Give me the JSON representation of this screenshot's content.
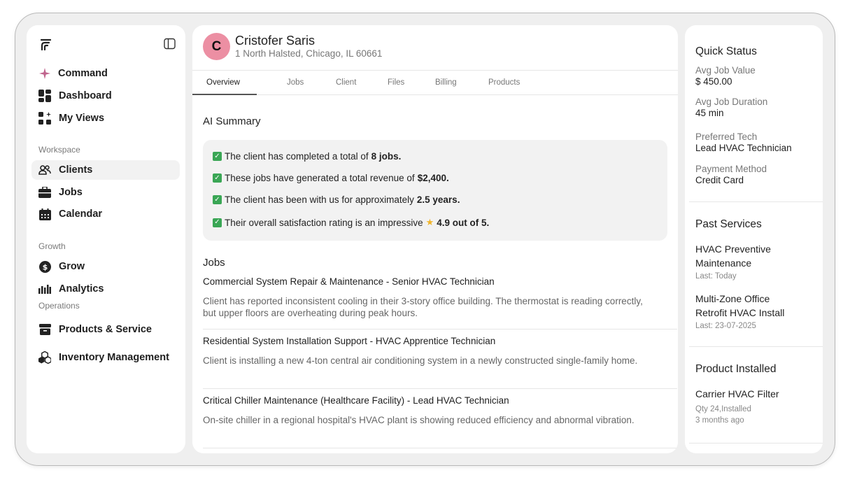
{
  "sidebar": {
    "primary": [
      {
        "label": "Command",
        "icon": "sparkle-icon"
      },
      {
        "label": "Dashboard",
        "icon": "dashboard-grid-icon"
      },
      {
        "label": "My Views",
        "icon": "my-views-icon"
      }
    ],
    "workspace_label": "Workspace",
    "workspace": [
      {
        "label": "Clients",
        "icon": "users-icon"
      },
      {
        "label": "Jobs",
        "icon": "briefcase-icon"
      },
      {
        "label": "Calendar",
        "icon": "calendar-icon"
      }
    ],
    "growth_label": "Growth",
    "growth": [
      {
        "label": "Grow",
        "icon": "dollar-coin-icon"
      },
      {
        "label": "Analytics",
        "icon": "bar-chart-icon"
      }
    ],
    "operations_label": "Operations",
    "operations": [
      {
        "label": "Products & Service",
        "icon": "box-icon"
      },
      {
        "label": "Inventory Management",
        "icon": "boxes-icon"
      }
    ]
  },
  "client": {
    "initial": "C",
    "name": "Cristofer Saris",
    "address": "1 North Halsted, Chicago, IL 60661",
    "avatar_color": "#ec8fa3"
  },
  "tabs": [
    "Overview",
    "Jobs",
    "Client",
    "Files",
    "Billing",
    "Products"
  ],
  "ai_summary": {
    "title": "AI Summary",
    "lines": [
      {
        "text": "The client has completed a total of",
        "bold": "8 jobs."
      },
      {
        "text": "These jobs have generated a total revenue of",
        "bold": "$2,400."
      },
      {
        "text": "The client has been with us for approximately",
        "bold": "2.5 years."
      },
      {
        "text": "Their overall satisfaction rating is an impressive",
        "bold": "4.9 out of 5."
      }
    ]
  },
  "jobs": {
    "title": "Jobs",
    "items": [
      {
        "title": "Commercial System Repair & Maintenance - Senior HVAC Technician",
        "desc": "Client has reported inconsistent cooling in their 3-story office building. The thermostat is reading correctly, but upper floors are overheating during peak hours."
      },
      {
        "title": "Residential System Installation Support - HVAC Apprentice Technician",
        "desc": "Client is installing a new 4-ton central air conditioning system in a newly constructed single-family home."
      },
      {
        "title": "Critical Chiller Maintenance (Healthcare Facility) - Lead HVAC Technician",
        "desc": "On-site chiller in a regional hospital's HVAC plant is showing reduced efficiency and abnormal vibration."
      }
    ]
  },
  "quick_status": {
    "title": "Quick Status",
    "items": [
      {
        "label": "Avg Job Value",
        "value": "$ 450.00"
      },
      {
        "label": "Avg Job Duration",
        "value": "45 min"
      },
      {
        "label": "Preferred Tech",
        "value": "Lead HVAC Technician"
      },
      {
        "label": "Payment Method",
        "value": "Credit Card"
      }
    ]
  },
  "past_services": {
    "title": "Past Services",
    "items": [
      {
        "name": "HVAC Preventive Maintenance",
        "last": "Last: Today"
      },
      {
        "name": "Multi-Zone Office Retrofit HVAC Install",
        "last": "Last: 23-07-2025"
      }
    ]
  },
  "product_installed": {
    "title": "Product Installed",
    "items": [
      {
        "name": "Carrier HVAC Filter",
        "qty": "Qty 24,Installed",
        "when": "3 months ago"
      }
    ]
  }
}
